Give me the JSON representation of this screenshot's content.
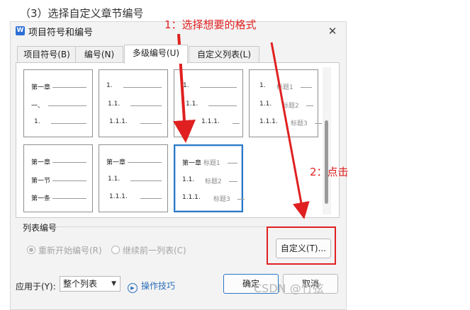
{
  "step_caption": "（3）选择自定义章节编号",
  "annotations": {
    "anno1": "1：选择想要的格式",
    "anno2": "2：点击"
  },
  "dialog": {
    "icon_letter": "W",
    "title": "项目符号和编号",
    "close": "✕",
    "tabs": [
      "项目符号(B)",
      "编号(N)",
      "多级编号(U)",
      "自定义列表(L)"
    ],
    "active_tab": 2
  },
  "options": [
    {
      "rows": [
        {
          "label": "第一章"
        },
        {
          "label": "一、"
        },
        {
          "label": "1."
        }
      ]
    },
    {
      "rows": [
        {
          "label": "1."
        },
        {
          "label": "1.1."
        },
        {
          "label": "1.1.1."
        }
      ]
    },
    {
      "rows": [
        {
          "label": "1."
        },
        {
          "label": "1.1."
        },
        {
          "label": "1.1.1."
        }
      ]
    },
    {
      "rows": [
        {
          "label": "1.",
          "heading": "标题1"
        },
        {
          "label": "1.1.",
          "heading": "标题2"
        },
        {
          "label": "1.1.1.",
          "heading": "标题3"
        }
      ]
    },
    {
      "rows": [
        {
          "label": "第一章"
        },
        {
          "label": "第一节"
        },
        {
          "label": "第一条"
        }
      ]
    },
    {
      "rows": [
        {
          "label": "第一章"
        },
        {
          "label": "1.1."
        },
        {
          "label": "1.1.1."
        }
      ]
    },
    {
      "selected": true,
      "rows": [
        {
          "label": "第一章",
          "heading": "标题1"
        },
        {
          "label": "1.1.",
          "heading": "标题2"
        },
        {
          "label": "1.1.1.",
          "heading": "标题3"
        }
      ]
    }
  ],
  "list_number": {
    "label": "列表编号",
    "restart": "重新开始编号(R)",
    "continue": "继续前一列表(C)",
    "custom_button": "自定义(T)..."
  },
  "footer": {
    "apply_label": "应用于(Y):",
    "apply_value": "整个列表",
    "tips": "操作技巧",
    "ok": "确定",
    "cancel": "取消"
  },
  "watermark": "CSDN @竹弦",
  "colors": {
    "annotation_red": "#e02020",
    "selection_blue": "#2a78c6",
    "link_blue": "#2a6ebb"
  }
}
